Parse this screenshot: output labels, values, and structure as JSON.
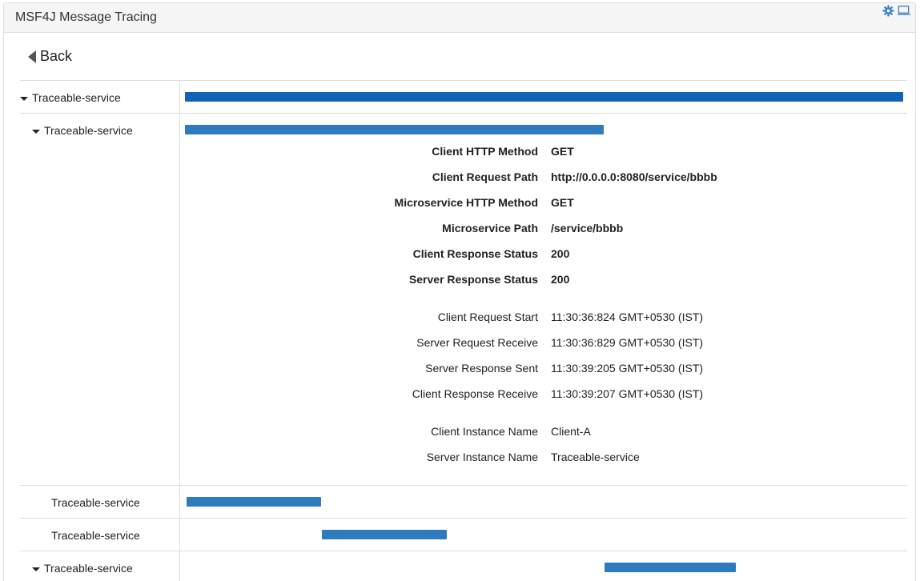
{
  "window": {
    "title": "MSF4J Message Tracing"
  },
  "header_icons": [
    "gear-icon",
    "maximize-icon"
  ],
  "back": {
    "label": "Back"
  },
  "colors": {
    "bar": "#2f7bbf",
    "root_bar": "#0f62b5",
    "border": "#dddddd",
    "header_bg": "#f5f5f5"
  },
  "spans": [
    {
      "name": "Traceable-service",
      "expanded": true,
      "level": 0
    },
    {
      "name": "Traceable-service",
      "expanded": true,
      "level": 1
    },
    {
      "name": "Traceable-service",
      "expanded": false,
      "level": 2
    },
    {
      "name": "Traceable-service",
      "expanded": false,
      "level": 2
    },
    {
      "name": "Traceable-service",
      "expanded": true,
      "level": 1
    }
  ],
  "details": {
    "client_http_method": {
      "label": "Client HTTP Method",
      "value": "GET"
    },
    "client_request_path": {
      "label": "Client Request Path",
      "value": "http://0.0.0.0:8080/service/bbbb"
    },
    "microservice_http_method": {
      "label": "Microservice HTTP Method",
      "value": "GET"
    },
    "microservice_path": {
      "label": "Microservice Path",
      "value": "/service/bbbb"
    },
    "client_response_status": {
      "label": "Client Response Status",
      "value": "200"
    },
    "server_response_status": {
      "label": "Server Response Status",
      "value": "200"
    },
    "client_request_start": {
      "label": "Client Request Start",
      "value": "11:30:36:824 GMT+0530 (IST)"
    },
    "server_request_receive": {
      "label": "Server Request Receive",
      "value": "11:30:36:829 GMT+0530 (IST)"
    },
    "server_response_sent": {
      "label": "Server Response Sent",
      "value": "11:30:39:205 GMT+0530 (IST)"
    },
    "client_response_receive": {
      "label": "Client Response Receive",
      "value": "11:30:39:207 GMT+0530 (IST)"
    },
    "client_instance_name": {
      "label": "Client Instance Name",
      "value": "Client-A"
    },
    "server_instance_name": {
      "label": "Server Instance Name",
      "value": "Traceable-service"
    }
  }
}
